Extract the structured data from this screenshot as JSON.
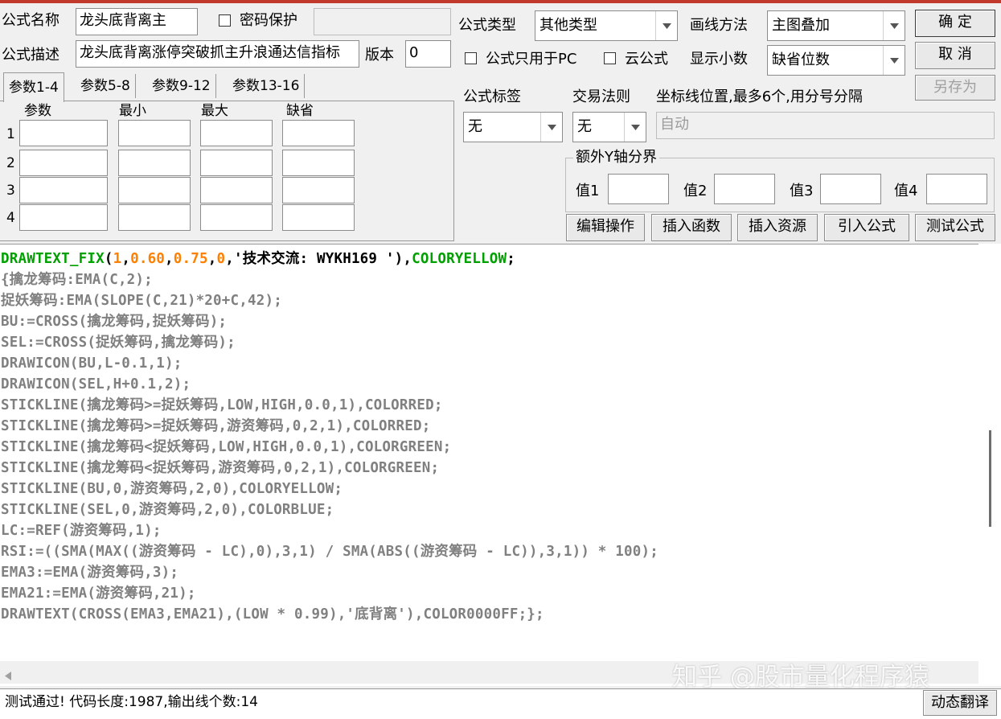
{
  "colors": {
    "title_accent": "#c0392b",
    "code_keyword_green": "#00a000",
    "code_number_orange": "#ff8000",
    "code_default_gray": "#808080"
  },
  "form": {
    "name_label": "公式名称",
    "name_value": "龙头底背离主",
    "password_label": "密码保护",
    "password_value": "",
    "desc_label": "公式描述",
    "desc_value": "龙头底背离涨停突破抓主升浪通达信指标",
    "version_label": "版本",
    "version_value": "0",
    "type_label": "公式类型",
    "type_value": "其他类型",
    "draw_label": "画线方法",
    "draw_value": "主图叠加",
    "pc_only_label": "公式只用于PC",
    "cloud_label": "云公式",
    "decimal_label": "显示小数",
    "decimal_value": "缺省位数",
    "tag_label": "公式标签",
    "tag_value": "无",
    "rule_label": "交易法则",
    "rule_value": "无",
    "axis_label": "坐标线位置,最多6个,用分号分隔",
    "axis_value": "自动",
    "extra_y_label": "额外Y轴分界",
    "val1_label": "值1",
    "val2_label": "值2",
    "val3_label": "值3",
    "val4_label": "值4"
  },
  "buttons": {
    "ok": "确  定",
    "cancel": "取  消",
    "save_as": "另存为",
    "edit_ops": "编辑操作",
    "insert_func": "插入函数",
    "insert_res": "插入资源",
    "import_formula": "引入公式",
    "test_formula": "测试公式",
    "dyn_translate": "动态翻译"
  },
  "tabs": [
    "参数1-4",
    "参数5-8",
    "参数9-12",
    "参数13-16"
  ],
  "param_headers": [
    "参数",
    "最小",
    "最大",
    "缺省"
  ],
  "param_rows": [
    "1",
    "2",
    "3",
    "4"
  ],
  "code_lines": [
    "DRAWTEXT_FIX(1,0.60,0.75,0,'技术交流: WYKH169 '),COLORYELLOW;",
    "{擒龙筹码:EMA(C,2);",
    "捉妖筹码:EMA(SLOPE(C,21)*20+C,42);",
    "BU:=CROSS(擒龙筹码,捉妖筹码);",
    "SEL:=CROSS(捉妖筹码,擒龙筹码);",
    "DRAWICON(BU,L-0.1,1);",
    "DRAWICON(SEL,H+0.1,2);",
    "STICKLINE(擒龙筹码>=捉妖筹码,LOW,HIGH,0.0,1),COLORRED;",
    "STICKLINE(擒龙筹码>=捉妖筹码,游资筹码,0,2,1),COLORRED;",
    "STICKLINE(擒龙筹码<捉妖筹码,LOW,HIGH,0.0,1),COLORGREEN;",
    "STICKLINE(擒龙筹码<捉妖筹码,游资筹码,0,2,1),COLORGREEN;",
    "STICKLINE(BU,0,游资筹码,2,0),COLORYELLOW;",
    "STICKLINE(SEL,0,游资筹码,2,0),COLORBLUE;",
    "LC:=REF(游资筹码,1);",
    "RSI:=((SMA(MAX((游资筹码 - LC),0),3,1) / SMA(ABS((游资筹码 - LC)),3,1)) * 100);",
    "EMA3:=EMA(游资筹码,3);",
    "EMA21:=EMA(游资筹码,21);",
    "DRAWTEXT(CROSS(EMA3,EMA21),(LOW * 0.99),'底背离'),COLOR0000FF;};"
  ],
  "status_text": "测试通过! 代码长度:1987,输出线个数:14",
  "watermark": "知乎 @股市量化程序猿"
}
